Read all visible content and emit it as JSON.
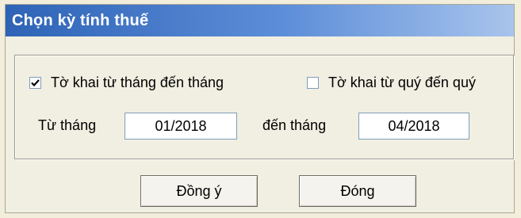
{
  "dialog": {
    "title": "Chọn kỳ tính thuế"
  },
  "options": {
    "by_month": {
      "label": "Tờ khai từ tháng đến tháng",
      "checked": true
    },
    "by_quarter": {
      "label": "Tờ khai từ quý đến quý",
      "checked": false
    }
  },
  "range": {
    "from_label": "Từ tháng",
    "from_value": "01/2018",
    "to_label": "đến tháng",
    "to_value": "04/2018"
  },
  "buttons": {
    "ok_label": "Đồng ý",
    "close_label": "Đóng"
  }
}
